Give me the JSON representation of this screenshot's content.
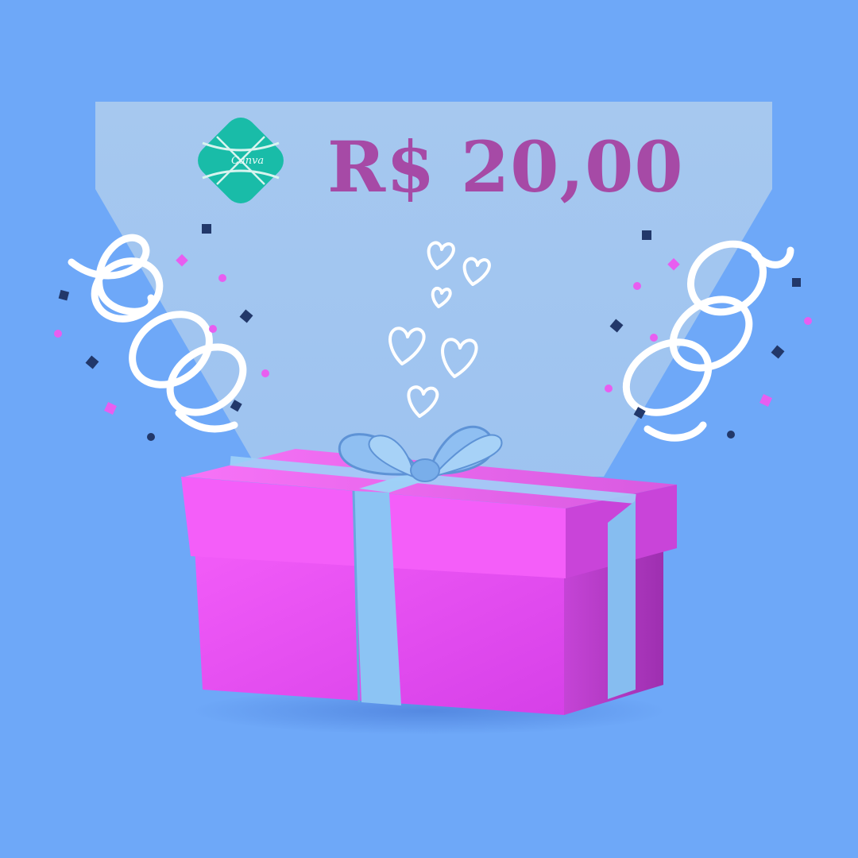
{
  "price_text": "R$ 20,00",
  "logo_word": "Canva",
  "colors": {
    "background": "#6ea8f8",
    "spotlight": "#a6c8ef",
    "price": "#a64aa6",
    "logo": "#19bca8",
    "gift_box": "#ea4ff2",
    "gift_box_dark": "#b43bc0",
    "ribbon": "#8cc4f4",
    "confetti_navy": "#22386a",
    "confetti_pink": "#e85ef0",
    "streamer": "#ffffff"
  },
  "icons": {
    "logo": "canva-diamond-logo-icon",
    "gift": "gift-box-icon",
    "hearts": "heart-icon",
    "streamers": "curly-streamer-icon",
    "confetti": "confetti-icon"
  }
}
